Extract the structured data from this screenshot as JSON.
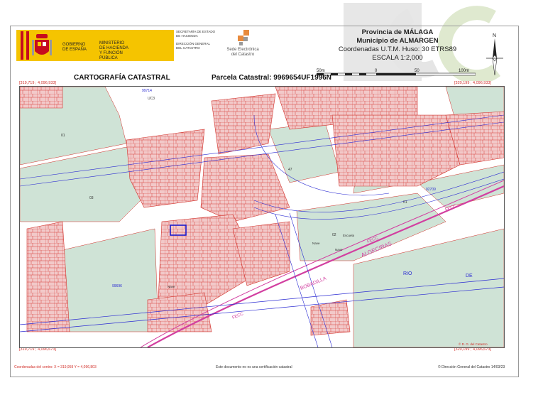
{
  "header": {
    "gov_line1": "GOBIERNO",
    "gov_line2": "DE ESPAÑA",
    "ministry_line1": "MINISTERIO",
    "ministry_line2": "DE HACIENDA",
    "ministry_line3": "Y FUNCIÓN PÚBLICA",
    "secretaria_line1": "SECRETARÍA DE ESTADO",
    "secretaria_line2": "DE HACIENDA",
    "direccion_line1": "DIRECCIÓN GENERAL",
    "direccion_line2": "DEL CATASTRO",
    "sede_line1": "Sede Electrónica",
    "sede_line2": "del Catastro"
  },
  "title_block": {
    "province": "Provincia de MÁLAGA",
    "municipality": "Municipio de ALMARGEN",
    "coordinates": "Coordenadas U.T.M. Huso: 30 ETRS89",
    "scale": "ESCALA 1:2,000"
  },
  "scale_bar": {
    "label_start": "50m",
    "label_zero": "0",
    "label_mid": "50",
    "label_end": "100m"
  },
  "north_label": "N",
  "map_title": "CARTOGRAFÍA CATASTRAL",
  "parcel_title": "Parcela Catastral: 9969654UF1996N",
  "corners": {
    "top_left": "[319,719 ; 4,096,933]",
    "top_right": "[320,199 ; 4,096,933]",
    "bottom_left": "[319,719 ; 4,096,673]",
    "bottom_right": "[320,199 ; 4,096,673]"
  },
  "map_labels": {
    "parcel_99714": "99714",
    "parcel_01": "01",
    "parcel_03": "03",
    "parcel_99696": "99696",
    "parcel_02709": "02709",
    "parcel_01_right": "01",
    "parcel_02": "02",
    "nave_1": "Nave",
    "nave_2": "Nave",
    "nave_3": "Nave",
    "escuela": "Escuela",
    "fecc_1": "FECC",
    "fecc_2": "FECC",
    "fecc_3": "FECC",
    "algeciras": "ALGECIRAS",
    "bobadilla": "BOBADILLA",
    "rio": "RIO",
    "de": "DE",
    "uc3": "UC3",
    "parcel_47": "47",
    "copyright": "© D. G. del Catastro"
  },
  "colors": {
    "building": "#f2c9c9",
    "edge": "#d2302a",
    "blue": "#2a2ad2",
    "green": "#cfe3d6",
    "gold": "#f5c400"
  },
  "footer": {
    "center_coords": "Coordenadas del centro: X = 319,959 Y = 4,096,803",
    "disclaimer": "Este documento no es una certificación catastral",
    "copyright": "© Dirección General del Catastro 14/03/23"
  }
}
